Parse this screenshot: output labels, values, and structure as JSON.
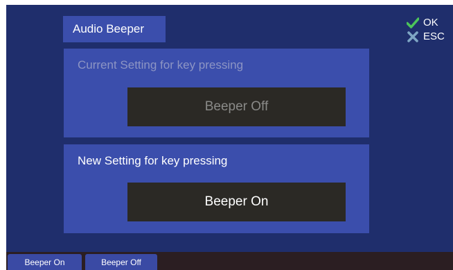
{
  "title": "Audio Beeper",
  "actions": {
    "ok_label": "OK",
    "esc_label": "ESC",
    "ok_icon": "checkmark-icon",
    "esc_icon": "x-icon",
    "ok_color": "#4cc45a",
    "esc_color": "#7fa6c4"
  },
  "current": {
    "heading": "Current Setting for key pressing",
    "value": "Beeper Off"
  },
  "new_setting": {
    "heading": "New Setting for key pressing",
    "value": "Beeper On"
  },
  "softkeys": [
    {
      "label": "Beeper On"
    },
    {
      "label": "Beeper Off"
    }
  ],
  "colors": {
    "background": "#1f2e6c",
    "panel": "#3b4eac",
    "value_box": "#2b2925",
    "footer": "#2b1e22"
  }
}
